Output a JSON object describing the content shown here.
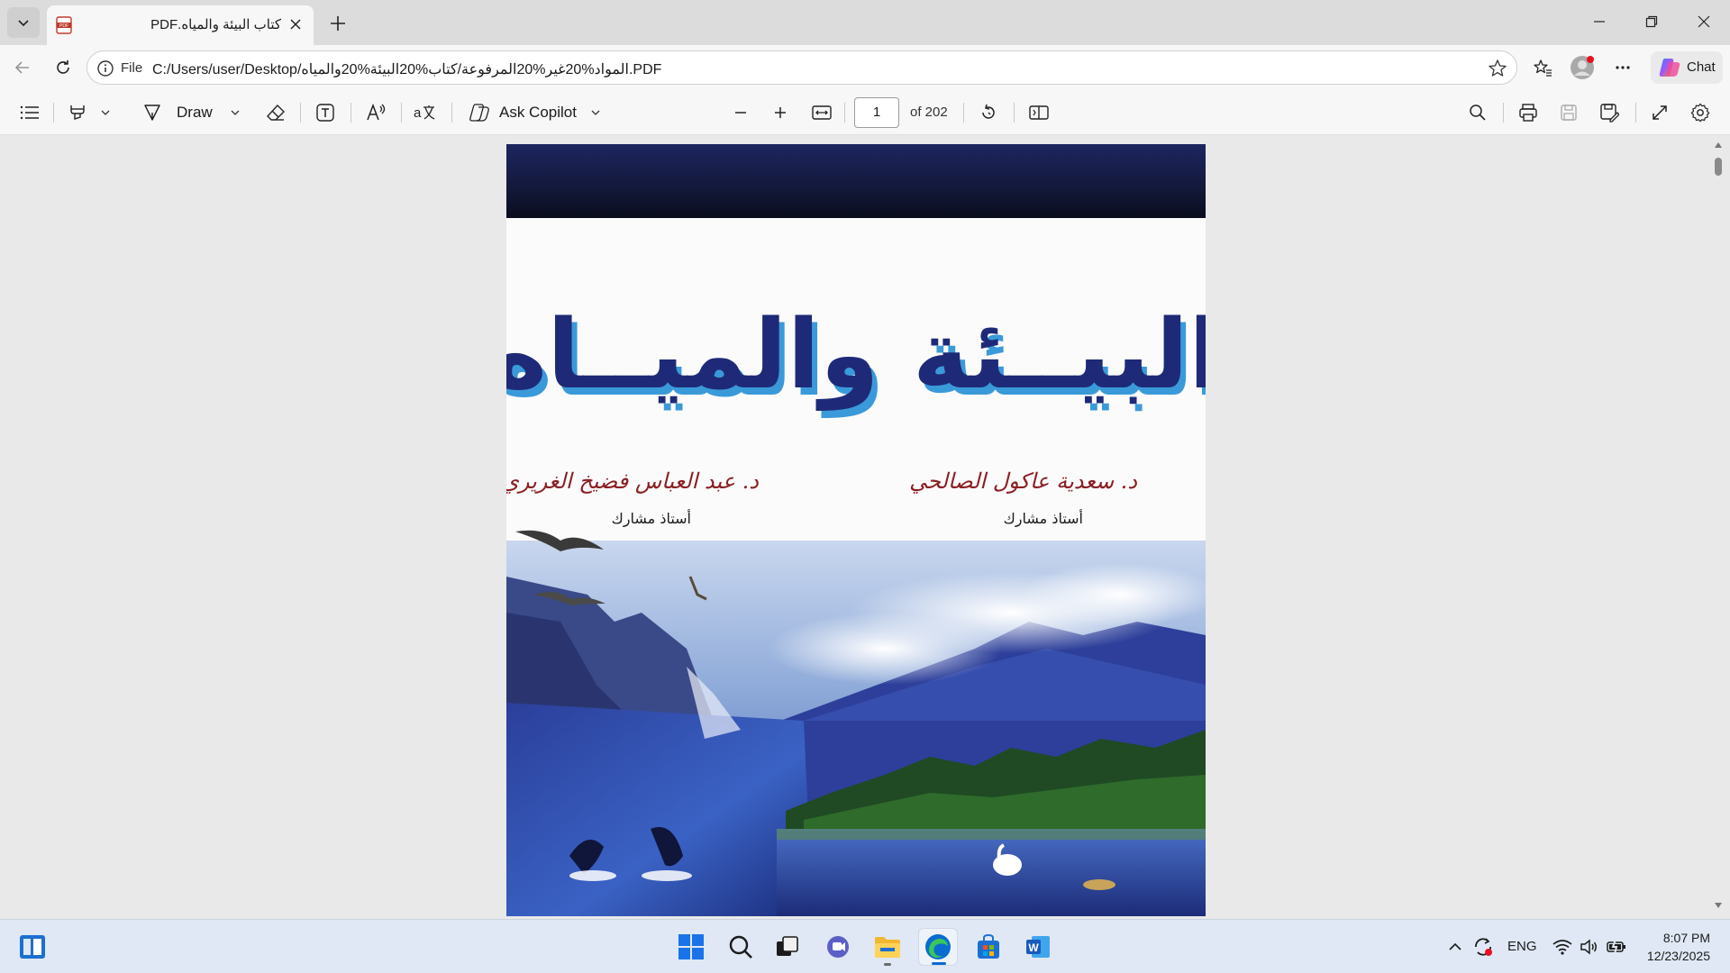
{
  "tab": {
    "title": "كتاب البيئة والمياه.PDF",
    "favicon": "pdf-file-icon"
  },
  "window_controls": [
    "minimize-icon",
    "restore-icon",
    "close-icon"
  ],
  "address_bar": {
    "scheme_label": "File",
    "url": "C:/Users/user/Desktop/المواد%20غير%20المرفوعة/كتاب%20البيئة%20والمياه.PDF"
  },
  "chat_button": {
    "label": "Chat"
  },
  "pdf_toolbar": {
    "draw_label": "Draw",
    "ask_copilot_label": "Ask Copilot",
    "page_current": "1",
    "page_total": "of 202"
  },
  "document": {
    "cover_title": "البيــئة والميــاه",
    "author_right": "د. سعدية عاكول الصالحي",
    "author_right_role": "أستاذ مشارك",
    "author_left": "د. عبد العباس فضيخ الغريري",
    "author_left_role": "أستاذ مشارك"
  },
  "taskbar": {
    "language": "ENG",
    "time": "8:07 PM",
    "date": "12/23/2025"
  },
  "colors": {
    "title_blue": "#1e2a78",
    "title_shadow": "#3a9ad9",
    "author_red": "#8a1f22",
    "edge_blue": "#0a6cd1",
    "copilot_gradient": [
      "#3b82f6",
      "#f59e0b",
      "#ec4899"
    ]
  }
}
